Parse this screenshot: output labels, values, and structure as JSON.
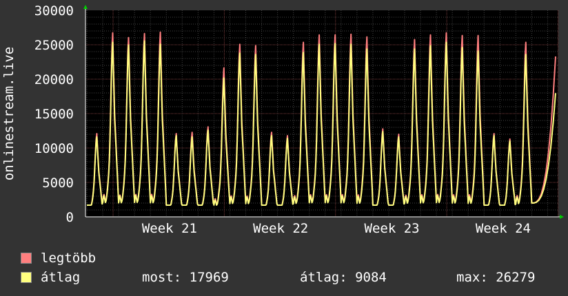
{
  "chart_data": {
    "type": "area",
    "ylabel": "onlinestream.live",
    "ylim": [
      0,
      30000
    ],
    "y_ticks": [
      0,
      5000,
      10000,
      15000,
      20000,
      25000,
      30000
    ],
    "x_ticks": [
      "Week 21",
      "Week 22",
      "Week 23",
      "Week 24"
    ],
    "days": 30,
    "series": [
      {
        "name": "legtöbb",
        "color": "#ff7f7f",
        "daily_peaks": [
          12300,
          27200,
          26500,
          27100,
          27300,
          12300,
          12500,
          13300,
          22000,
          25500,
          25300,
          12500,
          12000,
          25800,
          26900,
          26900,
          27000,
          26600,
          13000,
          12200,
          26200,
          26900,
          27200,
          26800,
          26800,
          12300,
          11500,
          25800
        ],
        "current": 23300
      },
      {
        "name": "átlag",
        "color": "#ffff7f",
        "daily_peaks": [
          11800,
          25800,
          25400,
          26000,
          25500,
          12000,
          11800,
          12800,
          20500,
          24200,
          24000,
          12000,
          11600,
          24300,
          25500,
          25600,
          25500,
          24800,
          12600,
          11800,
          24800,
          25300,
          25800,
          25000,
          24500,
          12000,
          11200,
          24000
        ],
        "current": 17969
      }
    ]
  },
  "legend": {
    "max_label": "legtöbb",
    "avg_label": "átlag",
    "now_text": "most: 17969",
    "avg_text": "átlag: 9084",
    "max_text": "max: 26279",
    "max_color": "#ff7f7f",
    "avg_color": "#ffff7f"
  }
}
